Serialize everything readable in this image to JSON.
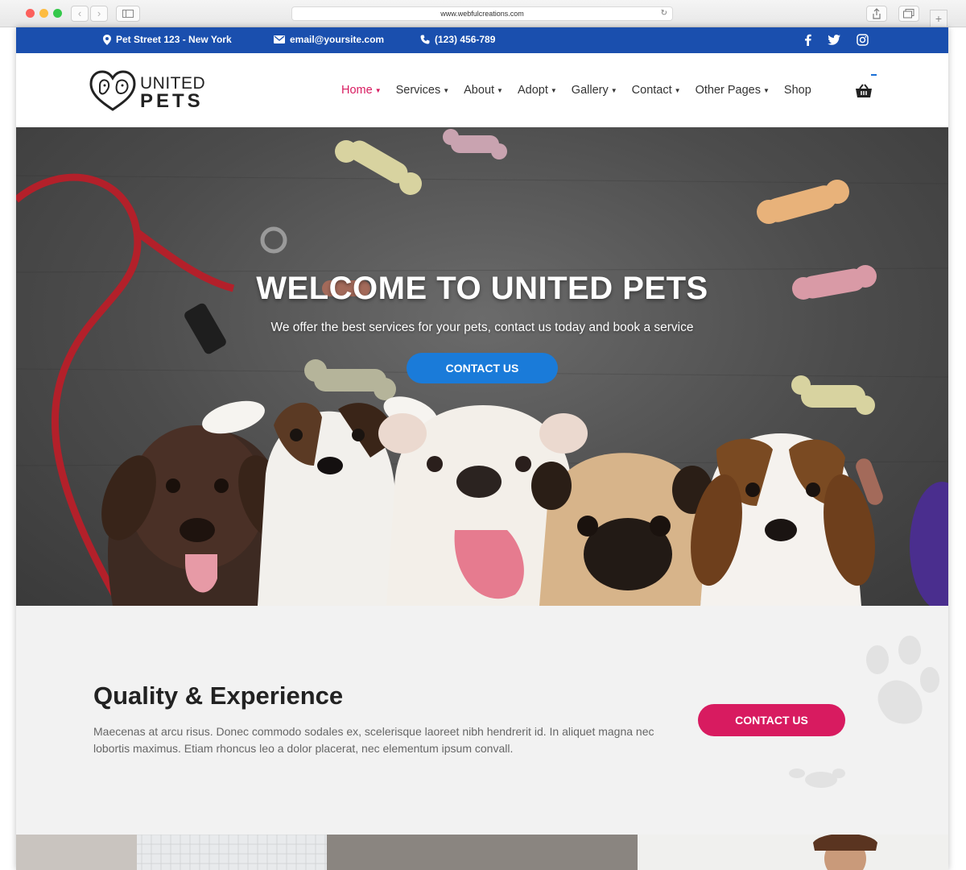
{
  "browser": {
    "url": "www.webfulcreations.com"
  },
  "topbar": {
    "address": "Pet Street 123 - New York",
    "email": "email@yoursite.com",
    "phone": "(123) 456-789"
  },
  "logo": {
    "line1": "UNITED",
    "line2": "PETS"
  },
  "nav": {
    "items": [
      {
        "label": "Home",
        "active": true
      },
      {
        "label": "Services"
      },
      {
        "label": "About"
      },
      {
        "label": "Adopt"
      },
      {
        "label": "Gallery"
      },
      {
        "label": "Contact"
      },
      {
        "label": "Other Pages"
      },
      {
        "label": "Shop"
      }
    ]
  },
  "hero": {
    "title": "WELCOME TO UNITED PETS",
    "subtitle": "We offer the best services for your pets, contact us today and book a service",
    "button": "CONTACT US"
  },
  "quality": {
    "title": "Quality & Experience",
    "text": "Maecenas at arcu risus. Donec commodo sodales ex, scelerisque laoreet nibh hendrerit id. In aliquet magna nec lobortis maximus. Etiam rhoncus leo a dolor placerat, nec elementum ipsum convall.",
    "button": "CONTACT US"
  },
  "colors": {
    "topbar": "#1a4fae",
    "accent_pink": "#d81b60",
    "accent_blue": "#1a7bd9"
  }
}
